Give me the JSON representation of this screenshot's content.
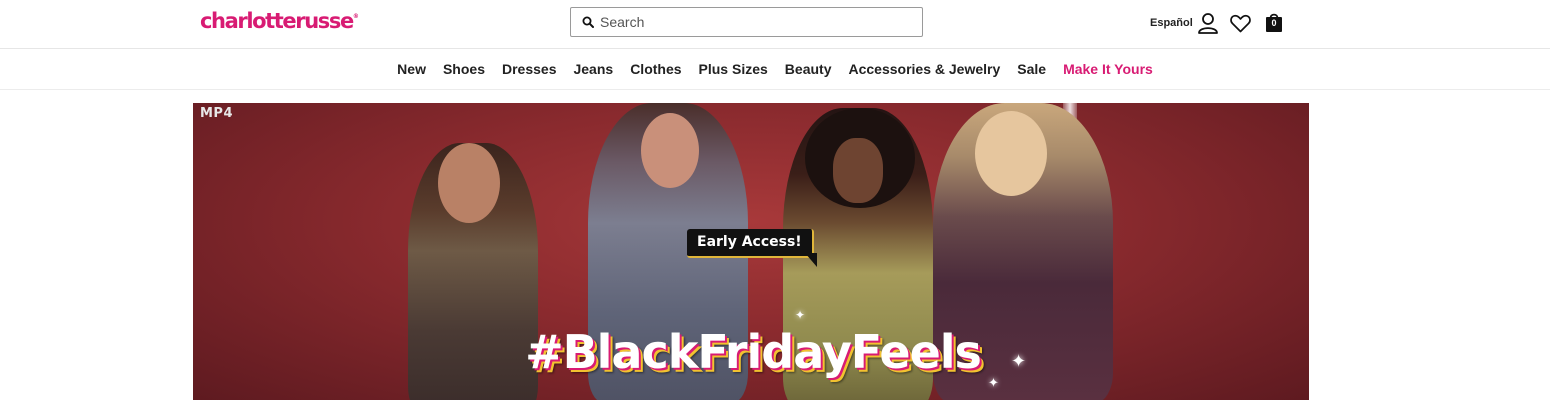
{
  "header": {
    "logo_text": "charlotterusse",
    "logo_mark": "®",
    "search_placeholder": "Search",
    "language_link": "Español",
    "bag_count": "0",
    "icons": [
      "search-icon",
      "user-icon",
      "heart-icon",
      "bag-icon"
    ]
  },
  "nav": {
    "items": [
      {
        "label": "New"
      },
      {
        "label": "Shoes"
      },
      {
        "label": "Dresses"
      },
      {
        "label": "Jeans"
      },
      {
        "label": "Clothes"
      },
      {
        "label": "Plus Sizes"
      },
      {
        "label": "Beauty"
      },
      {
        "label": "Accessories & Jewelry"
      },
      {
        "label": "Sale"
      },
      {
        "label": "Make It Yours"
      }
    ]
  },
  "hero": {
    "media_tag": "MP4",
    "bubble": "Early Access!",
    "headline": "#BlackFridayFeels"
  },
  "colors": {
    "brand": "#d81b73",
    "hero_background": "#8a2a2e",
    "headline_shadow_1": "#d81b73",
    "headline_shadow_2": "#f2c230"
  }
}
